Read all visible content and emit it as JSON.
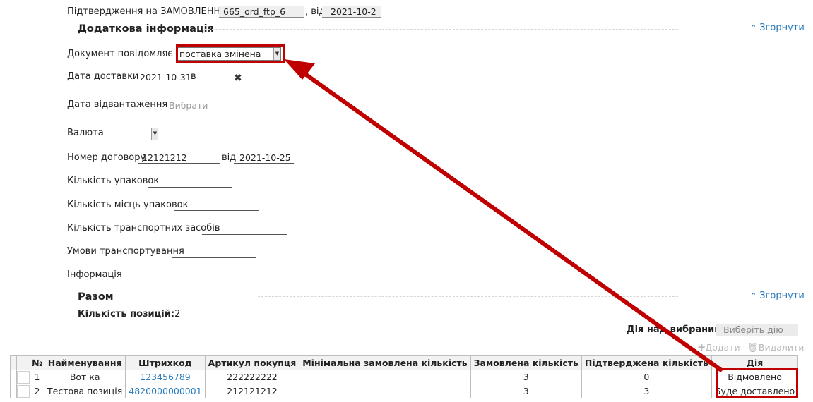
{
  "header": {
    "confirmation_label": "Підтвердження на ЗАМОВЛЕННЯ №",
    "order_number": "665_ord_ftp_6",
    "from_label": ", від",
    "order_date": "2021-10-2"
  },
  "additional": {
    "title": "Додаткова інформація",
    "collapse_label": "Згорнути",
    "document_notifies_label": "Документ повідомляє що",
    "document_notifies_value": "поставка змінена",
    "delivery_date_label": "Дата доставки",
    "delivery_date_value": "2021-10-31",
    "at_label": "в",
    "shipment_date_label": "Дата відвантаження",
    "shipment_date_placeholder": "Вибрати",
    "currency_label": "Валюта",
    "contract_number_label": "Номер договору",
    "contract_number_value": "12121212",
    "contract_from_label": "від",
    "contract_date_value": "2021-10-25",
    "packages_count_label": "Кількість упаковок",
    "package_places_label": "Кількість місць упаковок",
    "vehicles_count_label": "Кількість транспортних засобів",
    "transport_terms_label": "Умови транспортування",
    "info_label": "Інформація"
  },
  "summary": {
    "title": "Разом",
    "collapse_label": "Згорнути",
    "positions_label": "Кількість позицій:",
    "positions_value": "2"
  },
  "actions": {
    "selected_label": "Дія над вибраними:",
    "selected_placeholder": "Виберіть дію",
    "add_label": "Додати",
    "delete_label": "Видалити"
  },
  "table": {
    "columns": [
      "№",
      "Найменування",
      "Штрихкод",
      "Артикул покупця",
      "Мінімальна замовлена кількість",
      "Замовлена кількість",
      "Підтверджена кількість",
      "Дія"
    ],
    "rows": [
      {
        "num": "1",
        "name": "Вот ка",
        "barcode": "123456789",
        "article": "222222222",
        "min_qty": "",
        "ordered": "3",
        "confirmed": "0",
        "action": "Відмовлено"
      },
      {
        "num": "2",
        "name": "Тестова позиція",
        "barcode": "4820000000001",
        "article": "212121212",
        "min_qty": "",
        "ordered": "3",
        "confirmed": "3",
        "action": "Буде доставлено"
      }
    ]
  },
  "annotation": {
    "color": "#c00000"
  }
}
